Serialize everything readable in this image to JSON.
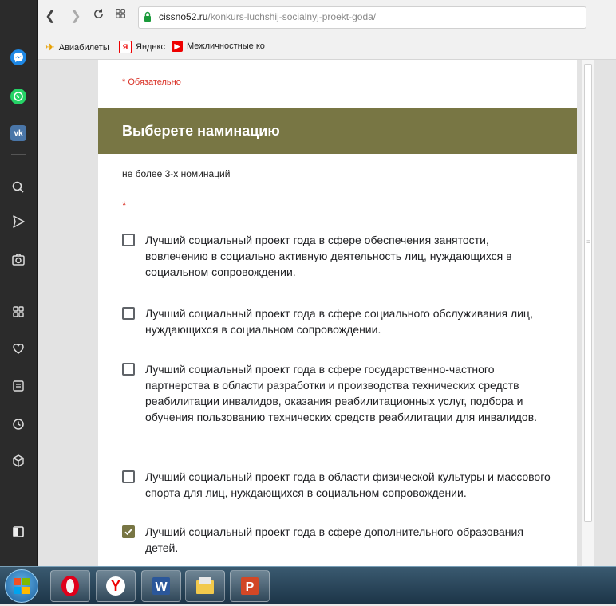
{
  "browser": {
    "url_host": "cissno52.ru",
    "url_path": "/konkurs-luchshij-socialnyj-proekt-goda/",
    "bookmarks": [
      {
        "label": "Авиабилеты",
        "icon": "plane-icon"
      },
      {
        "label": "Яндекс",
        "icon": "yandex-icon"
      },
      {
        "label": "Межличностные ко",
        "icon": "youtube-icon"
      }
    ]
  },
  "form": {
    "required_note": "* Обязательно",
    "section_title": "Выберете наминацию",
    "description": "не более 3-х номинаций",
    "required_star": "*",
    "accent_color": "#787644",
    "options": [
      {
        "label": "Лучший социальный проект года в сфере обеспечения занятости, вовлечению в социально активную деятельность лиц, нуждающихся в социальном сопровождении.",
        "checked": false
      },
      {
        "label": "Лучший социальный проект года в сфере социального обслуживания лиц, нуждающихся в социальном сопровождении.",
        "checked": false
      },
      {
        "label": "Лучший социальный проект года в сфере государственно-частного партнерства в области разработки и производства технических средств реабилитации инвалидов, оказания реабилитационных услуг, подбора и обучения пользованию технических средств реабилитации для инвалидов.",
        "checked": false
      },
      {
        "label": "Лучший социальный проект года в области физической культуры и массового спорта для лиц, нуждающихся в социальном сопровождении.",
        "checked": false
      },
      {
        "label": "Лучший социальный проект года в сфере дополнительного образования детей.",
        "checked": true
      }
    ]
  },
  "sidebar_icons": [
    "messenger-icon",
    "whatsapp-icon",
    "vk-icon",
    "search-icon",
    "send-icon",
    "camera-icon",
    "grid-icon",
    "heart-icon",
    "news-icon",
    "history-icon",
    "box-icon",
    "sidebar-toggle-icon"
  ],
  "taskbar_apps": [
    "windows-start",
    "opera-icon",
    "yandex-browser-icon",
    "word-icon",
    "file-manager-icon",
    "powerpoint-icon"
  ]
}
